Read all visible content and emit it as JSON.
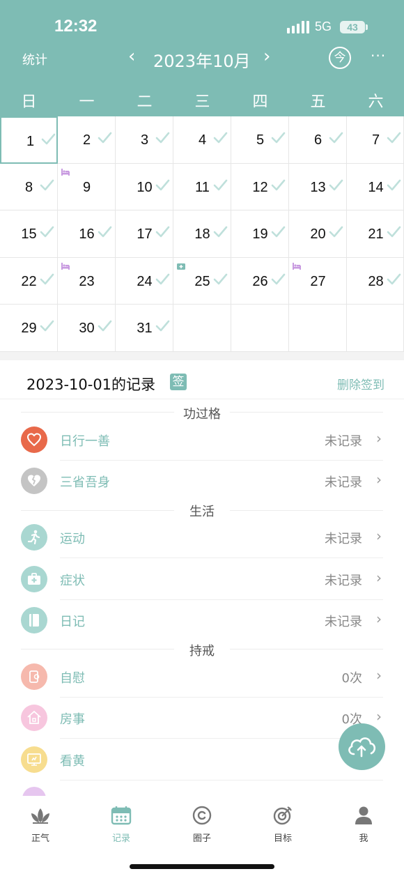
{
  "status": {
    "time": "12:32",
    "network": "5G",
    "battery": "43"
  },
  "header": {
    "stats_label": "统计",
    "month_title": "2023年10月",
    "prev": "‹",
    "next": "›",
    "today": "今",
    "more": "···"
  },
  "weekdays": [
    "日",
    "一",
    "二",
    "三",
    "四",
    "五",
    "六"
  ],
  "calendar": {
    "days": [
      "1",
      "2",
      "3",
      "4",
      "5",
      "6",
      "7",
      "8",
      "9",
      "10",
      "11",
      "12",
      "13",
      "14",
      "15",
      "16",
      "17",
      "18",
      "19",
      "20",
      "21",
      "22",
      "23",
      "24",
      "25",
      "26",
      "27",
      "28",
      "29",
      "30",
      "31"
    ],
    "checked": [
      1,
      2,
      3,
      4,
      5,
      6,
      7,
      8,
      10,
      11,
      12,
      13,
      14,
      15,
      16,
      17,
      18,
      19,
      20,
      21,
      22,
      24,
      25,
      26,
      28,
      29,
      30,
      31
    ],
    "selected_day": 1
  },
  "record": {
    "title": "2023-10-01的记录",
    "sign_badge": "签",
    "delete_sign": "删除签到"
  },
  "groups": [
    {
      "title": "功过格",
      "items": [
        {
          "label": "日行一善",
          "value": "未记录",
          "icon": "heart-icon",
          "color": "#e8694a"
        },
        {
          "label": "三省吾身",
          "value": "未记录",
          "icon": "broken-heart-icon",
          "color": "#c4c4c4"
        }
      ]
    },
    {
      "title": "生活",
      "items": [
        {
          "label": "运动",
          "value": "未记录",
          "icon": "runner-icon",
          "color": "#a9d7d1"
        },
        {
          "label": "症状",
          "value": "未记录",
          "icon": "medical-kit-icon",
          "color": "#a9d7d1"
        },
        {
          "label": "日记",
          "value": "未记录",
          "icon": "diary-icon",
          "color": "#a9d7d1"
        }
      ]
    },
    {
      "title": "持戒",
      "items": [
        {
          "label": "自慰",
          "value": "0次",
          "icon": "tissue-icon",
          "color": "#f6b9ad"
        },
        {
          "label": "房事",
          "value": "0次",
          "icon": "house-icon",
          "color": "#f7c6de"
        },
        {
          "label": "看黄",
          "value": "",
          "icon": "monitor-icon",
          "color": "#f7dd8f"
        }
      ]
    }
  ],
  "tabs": [
    {
      "label": "正气",
      "icon": "lotus-icon",
      "active": false
    },
    {
      "label": "记录",
      "icon": "calendar-icon",
      "active": true
    },
    {
      "label": "圈子",
      "icon": "circle-icon",
      "active": false
    },
    {
      "label": "目标",
      "icon": "target-icon",
      "active": false
    },
    {
      "label": "我",
      "icon": "person-icon",
      "active": false
    }
  ],
  "colors": {
    "accent": "#7ebcb4",
    "check": "#bfe0db"
  }
}
